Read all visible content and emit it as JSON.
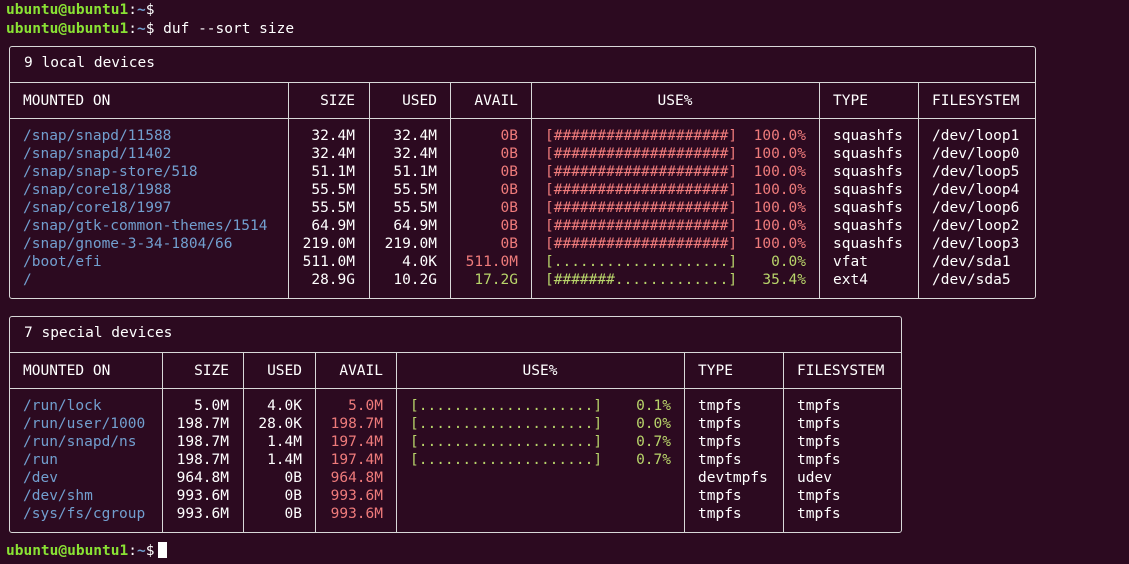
{
  "terminal": {
    "prompt_user": "ubuntu@ubuntu1",
    "prompt_sep": ":",
    "prompt_path": "~",
    "prompt_char": "$",
    "command": "duf --sort size"
  },
  "local": {
    "title": "9 local devices",
    "headers": [
      "MOUNTED ON",
      "SIZE",
      "USED",
      "AVAIL",
      "USE%",
      "TYPE",
      "FILESYSTEM"
    ],
    "rows": [
      {
        "mount": "/snap/snapd/11588",
        "size": "32.4M",
        "used": "32.4M",
        "avail": "0B",
        "bar": "[####################]",
        "pct": "100.0%",
        "type": "squashfs",
        "fs": "/dev/loop1",
        "level": "full"
      },
      {
        "mount": "/snap/snapd/11402",
        "size": "32.4M",
        "used": "32.4M",
        "avail": "0B",
        "bar": "[####################]",
        "pct": "100.0%",
        "type": "squashfs",
        "fs": "/dev/loop0",
        "level": "full"
      },
      {
        "mount": "/snap/snap-store/518",
        "size": "51.1M",
        "used": "51.1M",
        "avail": "0B",
        "bar": "[####################]",
        "pct": "100.0%",
        "type": "squashfs",
        "fs": "/dev/loop5",
        "level": "full"
      },
      {
        "mount": "/snap/core18/1988",
        "size": "55.5M",
        "used": "55.5M",
        "avail": "0B",
        "bar": "[####################]",
        "pct": "100.0%",
        "type": "squashfs",
        "fs": "/dev/loop4",
        "level": "full"
      },
      {
        "mount": "/snap/core18/1997",
        "size": "55.5M",
        "used": "55.5M",
        "avail": "0B",
        "bar": "[####################]",
        "pct": "100.0%",
        "type": "squashfs",
        "fs": "/dev/loop6",
        "level": "full"
      },
      {
        "mount": "/snap/gtk-common-themes/1514",
        "size": "64.9M",
        "used": "64.9M",
        "avail": "0B",
        "bar": "[####################]",
        "pct": "100.0%",
        "type": "squashfs",
        "fs": "/dev/loop2",
        "level": "full"
      },
      {
        "mount": "/snap/gnome-3-34-1804/66",
        "size": "219.0M",
        "used": "219.0M",
        "avail": "0B",
        "bar": "[####################]",
        "pct": "100.0%",
        "type": "squashfs",
        "fs": "/dev/loop3",
        "level": "full"
      },
      {
        "mount": "/boot/efi",
        "size": "511.0M",
        "used": "4.0K",
        "avail": "511.0M",
        "bar": "[....................]",
        "pct": "0.0%",
        "type": "vfat",
        "fs": "/dev/sda1",
        "level": "low"
      },
      {
        "mount": "/",
        "size": "28.9G",
        "used": "10.2G",
        "avail": "17.2G",
        "bar": "[#######.............]",
        "pct": "35.4%",
        "type": "ext4",
        "fs": "/dev/sda5",
        "level": "ok"
      }
    ]
  },
  "special": {
    "title": "7 special devices",
    "headers": [
      "MOUNTED ON",
      "SIZE",
      "USED",
      "AVAIL",
      "USE%",
      "TYPE",
      "FILESYSTEM"
    ],
    "rows": [
      {
        "mount": "/run/lock",
        "size": "5.0M",
        "used": "4.0K",
        "avail": "5.0M",
        "bar": "[....................]",
        "pct": "0.1%",
        "type": "tmpfs",
        "fs": "tmpfs"
      },
      {
        "mount": "/run/user/1000",
        "size": "198.7M",
        "used": "28.0K",
        "avail": "198.7M",
        "bar": "[....................]",
        "pct": "0.0%",
        "type": "tmpfs",
        "fs": "tmpfs"
      },
      {
        "mount": "/run/snapd/ns",
        "size": "198.7M",
        "used": "1.4M",
        "avail": "197.4M",
        "bar": "[....................]",
        "pct": "0.7%",
        "type": "tmpfs",
        "fs": "tmpfs"
      },
      {
        "mount": "/run",
        "size": "198.7M",
        "used": "1.4M",
        "avail": "197.4M",
        "bar": "[....................]",
        "pct": "0.7%",
        "type": "tmpfs",
        "fs": "tmpfs"
      },
      {
        "mount": "/dev",
        "size": "964.8M",
        "used": "0B",
        "avail": "964.8M",
        "bar": "",
        "pct": "",
        "type": "devtmpfs",
        "fs": "udev"
      },
      {
        "mount": "/dev/shm",
        "size": "993.6M",
        "used": "0B",
        "avail": "993.6M",
        "bar": "",
        "pct": "",
        "type": "tmpfs",
        "fs": "tmpfs"
      },
      {
        "mount": "/sys/fs/cgroup",
        "size": "993.6M",
        "used": "0B",
        "avail": "993.6M",
        "bar": "",
        "pct": "",
        "type": "tmpfs",
        "fs": "tmpfs"
      }
    ]
  },
  "colors": {
    "background": "#2c0a20",
    "prompt_user": "#8ae234",
    "prompt_path": "#729fcf",
    "mount": "#729fcf",
    "full": "#ef7b7b",
    "low": "#b8d46a"
  }
}
